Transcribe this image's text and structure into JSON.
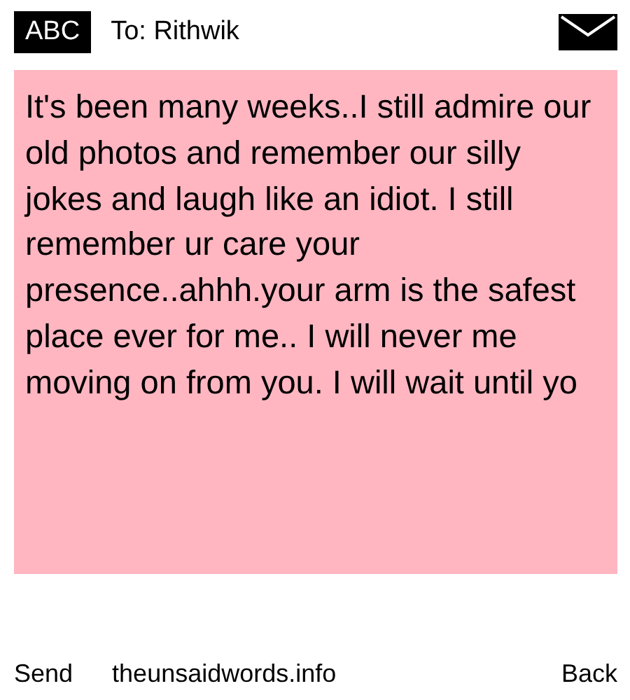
{
  "header": {
    "input_mode": "ABC",
    "recipient": "To: Rithwik"
  },
  "message": {
    "text": "It's been many weeks..I still admire our old photos and remember our silly jokes and laugh like an idiot. I still remember ur care your presence..ahhh.your arm is the safest place ever for me.. I will never me moving on from you. I will wait until yo"
  },
  "softkeys": {
    "left": "Send",
    "center": "theunsaidwords.info",
    "right": "Back"
  }
}
